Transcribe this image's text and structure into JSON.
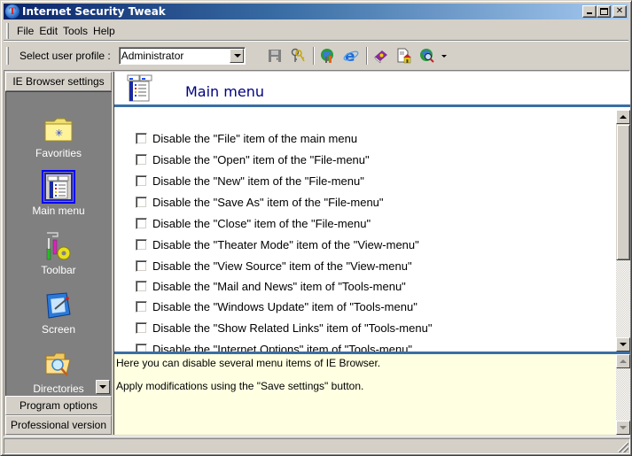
{
  "window": {
    "title": "Internet Security Tweak"
  },
  "menubar": {
    "items": [
      {
        "label": "File"
      },
      {
        "label": "Edit"
      },
      {
        "label": "Tools"
      },
      {
        "label": "Help"
      }
    ]
  },
  "toolbar": {
    "profile_label": "Select user profile :",
    "profile_value": "Administrator",
    "icons": [
      "save-icon",
      "keys-icon",
      "internet-tools-icon",
      "internet-explorer-icon",
      "help-book-icon",
      "home-page-icon",
      "web-globe-icon"
    ]
  },
  "left_panel": {
    "top_section": "IE Browser settings",
    "nav_items": [
      {
        "label": "Favorities",
        "icon": "favorites-folder-icon",
        "selected": false
      },
      {
        "label": "Main menu",
        "icon": "main-menu-icon",
        "selected": true
      },
      {
        "label": "Toolbar",
        "icon": "toolbar-tools-icon",
        "selected": false
      },
      {
        "label": "Screen",
        "icon": "screen-icon",
        "selected": false
      },
      {
        "label": "Directories",
        "icon": "directories-search-icon",
        "selected": false
      }
    ],
    "bottom_sections": [
      {
        "label": "Program options"
      },
      {
        "label": "Professional version"
      }
    ]
  },
  "main": {
    "title": "Main menu",
    "options": [
      {
        "label": "Disable the \"File\" item of the main menu",
        "checked": false
      },
      {
        "label": "Disable the \"Open\" item of the \"File-menu\"",
        "checked": false
      },
      {
        "label": "Disable the \"New\" item of the \"File-menu\"",
        "checked": false
      },
      {
        "label": "Disable the \"Save As\" item of the \"File-menu\"",
        "checked": false
      },
      {
        "label": "Disable the \"Close\" item of the \"File-menu\"",
        "checked": false
      },
      {
        "label": "Disable the \"Theater Mode\" item of the \"View-menu\"",
        "checked": false
      },
      {
        "label": "Disable the \"View Source\" item of the \"View-menu\"",
        "checked": false
      },
      {
        "label": "Disable the \"Mail and News\" item of \"Tools-menu\"",
        "checked": false
      },
      {
        "label": "Disable the \"Windows Update\" item of \"Tools-menu\"",
        "checked": false
      },
      {
        "label": "Disable the \"Show Related Links\" item of \"Tools-menu\"",
        "checked": false
      },
      {
        "label": "Disable the \"Internet Options\" item of \"Tools-menu\"",
        "checked": false
      }
    ],
    "description": [
      "Here you can disable several menu items of IE Browser.",
      "Apply modifications using the \"Save settings\" button."
    ]
  },
  "colors": {
    "title_gradient_start": "#0a246a",
    "title_gradient_end": "#a6caf0",
    "accent_divider": "#3a6ea5",
    "page_title": "#000080",
    "description_bg": "#ffffe1",
    "nav_bg": "#808080"
  }
}
